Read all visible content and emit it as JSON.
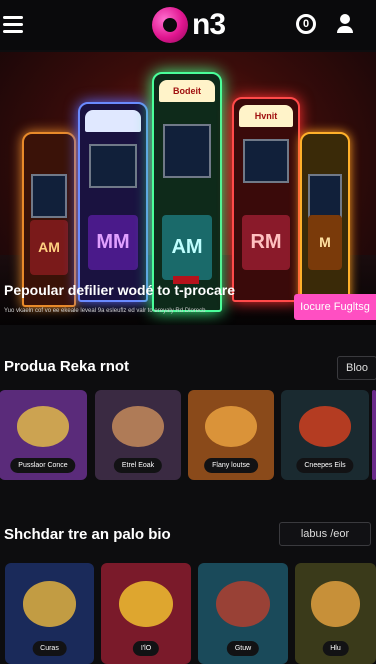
{
  "header": {
    "logo_text": "n3",
    "coin_icon_glyph": "0"
  },
  "hero": {
    "badge": "",
    "title": "Pepoular defilier wodé to t-procare",
    "subtitle": "Yuo vkaeln cof vo ee ekeale leveal 9a esleuflz ed valr to ereyaly Rd Dlorecb",
    "cta": "Iocure Fugltsg",
    "cabinets": [
      {
        "top": "",
        "screen": "AM"
      },
      {
        "top": "",
        "screen": "MM"
      },
      {
        "top": "Bodeit",
        "screen": "AM"
      },
      {
        "top": "Hvnit",
        "screen": "RM"
      },
      {
        "top": "",
        "screen": "M"
      }
    ]
  },
  "section1": {
    "title": "Produa Reka rnot",
    "button": "Bloo",
    "tiles": [
      {
        "label": "Pusslaor Conce",
        "bg": "#5a2b7a",
        "art": "#e0b84a"
      },
      {
        "label": "Etrel Eoak",
        "bg": "#3a2a42",
        "art": "#c48a5a"
      },
      {
        "label": "Flany loutse",
        "bg": "#8a4a1a",
        "art": "#e8a040"
      },
      {
        "label": "Cneepes Eils",
        "bg": "#1a2a30",
        "art": "#d04020"
      }
    ]
  },
  "section2": {
    "title": "Shchdar tre an palo bio",
    "button": "labus /eor",
    "tiles": [
      {
        "label": "Curas",
        "bg": "#1a2a5a",
        "art": "#e0b040"
      },
      {
        "label": "I'lO",
        "bg": "#7a1a2a",
        "art": "#f0c030"
      },
      {
        "label": "Gtuw",
        "bg": "#1a4a5a",
        "art": "#b04030"
      },
      {
        "label": "Hlu",
        "bg": "#3a3a1a",
        "art": "#e0a040"
      }
    ]
  },
  "colors": {
    "accent": "#ff4fc2",
    "logo": "#e0158f",
    "background": "#0d0d0f"
  }
}
